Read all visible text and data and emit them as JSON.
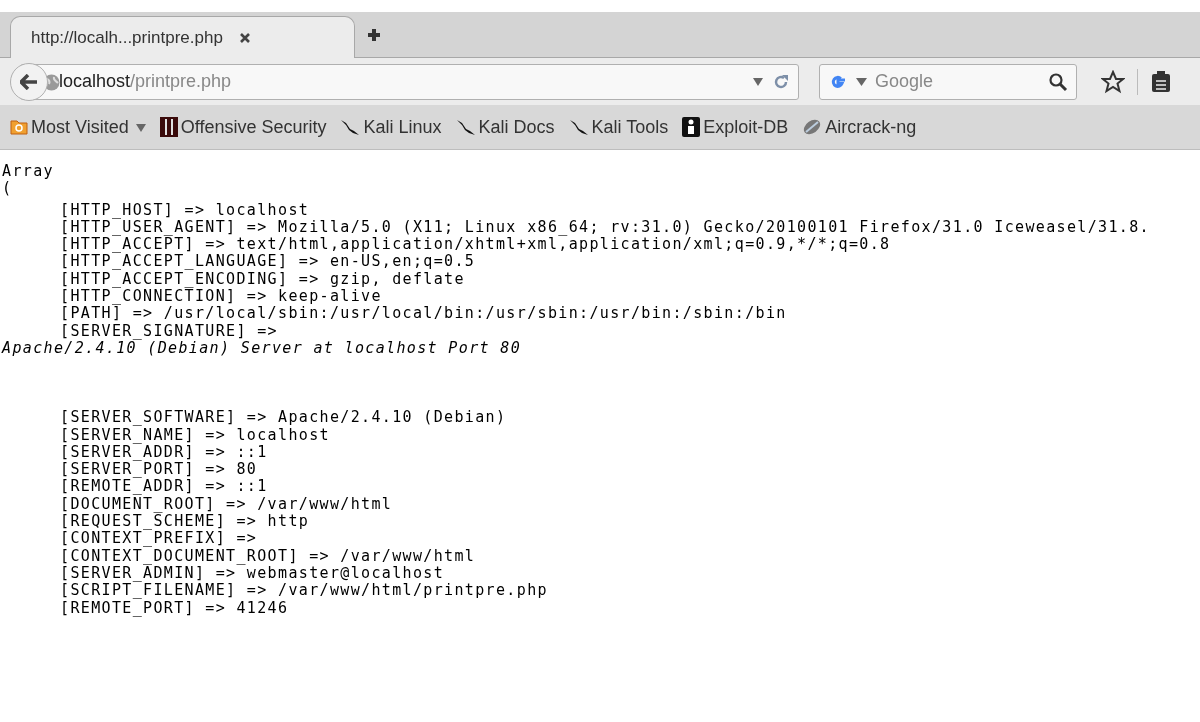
{
  "tab": {
    "title": "http://localh...printpre.php",
    "selected": true
  },
  "address_bar": {
    "host": "localhost",
    "path": "/printpre.php"
  },
  "search": {
    "placeholder": "Google"
  },
  "bookmarks": [
    {
      "label": "Most Visited",
      "kind": "folder"
    },
    {
      "label": "Offensive Security",
      "kind": "offsec"
    },
    {
      "label": "Kali Linux",
      "kind": "kali"
    },
    {
      "label": "Kali Docs",
      "kind": "kali"
    },
    {
      "label": "Kali Tools",
      "kind": "kali"
    },
    {
      "label": "Exploit-DB",
      "kind": "exploit"
    },
    {
      "label": "Aircrack-ng",
      "kind": "aircrack"
    }
  ],
  "content": {
    "lines": [
      {
        "kind": "plain",
        "text": "Array"
      },
      {
        "kind": "plain",
        "text": "("
      },
      {
        "kind": "entry",
        "text": "[HTTP_HOST] => localhost"
      },
      {
        "kind": "entry",
        "text": "[HTTP_USER_AGENT] => Mozilla/5.0 (X11; Linux x86_64; rv:31.0) Gecko/20100101 Firefox/31.0 Iceweasel/31.8."
      },
      {
        "kind": "entry",
        "text": "[HTTP_ACCEPT] => text/html,application/xhtml+xml,application/xml;q=0.9,*/*;q=0.8"
      },
      {
        "kind": "entry",
        "text": "[HTTP_ACCEPT_LANGUAGE] => en-US,en;q=0.5"
      },
      {
        "kind": "entry",
        "text": "[HTTP_ACCEPT_ENCODING] => gzip, deflate"
      },
      {
        "kind": "entry",
        "text": "[HTTP_CONNECTION] => keep-alive"
      },
      {
        "kind": "entry",
        "text": "[PATH] => /usr/local/sbin:/usr/local/bin:/usr/sbin:/usr/bin:/sbin:/bin"
      },
      {
        "kind": "entry",
        "text": "[SERVER_SIGNATURE] =>"
      },
      {
        "kind": "address",
        "text": "Apache/2.4.10 (Debian) Server at localhost Port 80"
      },
      {
        "kind": "entry",
        "text": "[SERVER_SOFTWARE] => Apache/2.4.10 (Debian)"
      },
      {
        "kind": "entry",
        "text": "[SERVER_NAME] => localhost"
      },
      {
        "kind": "entry",
        "text": "[SERVER_ADDR] => ::1"
      },
      {
        "kind": "entry",
        "text": "[SERVER_PORT] => 80"
      },
      {
        "kind": "entry",
        "text": "[REMOTE_ADDR] => ::1"
      },
      {
        "kind": "entry",
        "text": "[DOCUMENT_ROOT] => /var/www/html"
      },
      {
        "kind": "entry",
        "text": "[REQUEST_SCHEME] => http"
      },
      {
        "kind": "entry",
        "text": "[CONTEXT_PREFIX] =>"
      },
      {
        "kind": "entry",
        "text": "[CONTEXT_DOCUMENT_ROOT] => /var/www/html"
      },
      {
        "kind": "entry",
        "text": "[SERVER_ADMIN] => webmaster@localhost"
      },
      {
        "kind": "entry",
        "text": "[SCRIPT_FILENAME] => /var/www/html/printpre.php"
      },
      {
        "kind": "entry",
        "text": "[REMOTE_PORT] => 41246"
      }
    ]
  }
}
